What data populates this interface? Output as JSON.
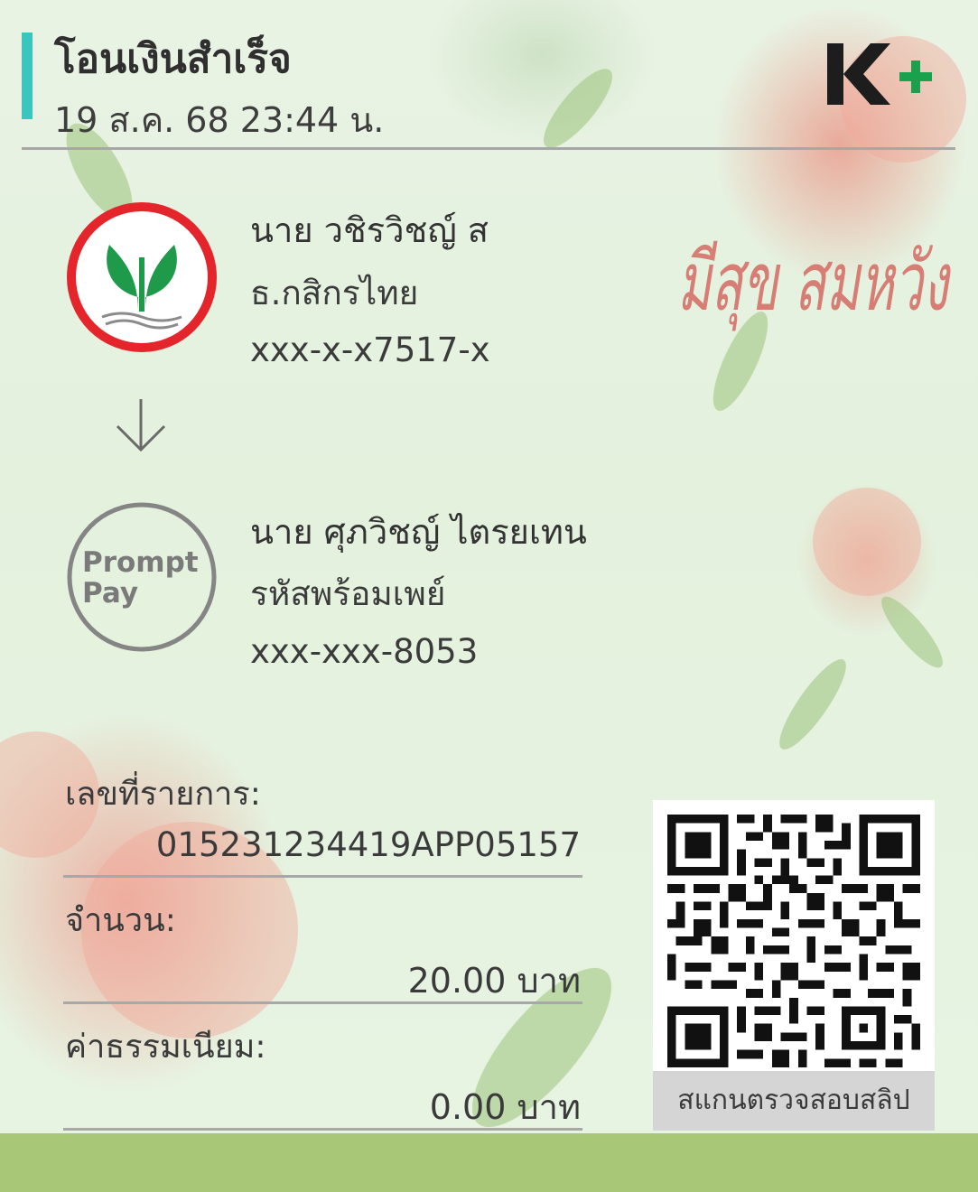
{
  "header": {
    "title": "โอนเงินสำเร็จ",
    "datetime": "19 ส.ค. 68  23:44 น.",
    "brand": "K+"
  },
  "sender": {
    "name": "นาย วชิรวิชญ์ ส",
    "bank": "ธ.กสิกรไทย",
    "account": "xxx-x-x7517-x"
  },
  "receiver": {
    "name": "นาย ศุภวิชญ์ ไตรยเทน",
    "channel": "รหัสพร้อมเพย์",
    "account": "xxx-xxx-8053",
    "logo_line1": "Prompt",
    "logo_line2": "Pay"
  },
  "decoration_text": "มีสุข สมหวัง",
  "details": {
    "ref_label": "เลขที่รายการ:",
    "ref_value": "015231234419APP05157",
    "amount_label": "จำนวน:",
    "amount_value": "20.00 บาท",
    "fee_label": "ค่าธรรมเนียม:",
    "fee_value": "0.00 บาท"
  },
  "qr": {
    "caption": "สแกนตรวจสอบสลิป"
  },
  "colors": {
    "accent": "#38c6bd",
    "kbank_green": "#1f9a4a",
    "kbank_red": "#e4262c",
    "bottom_bar": "#a8c877"
  }
}
